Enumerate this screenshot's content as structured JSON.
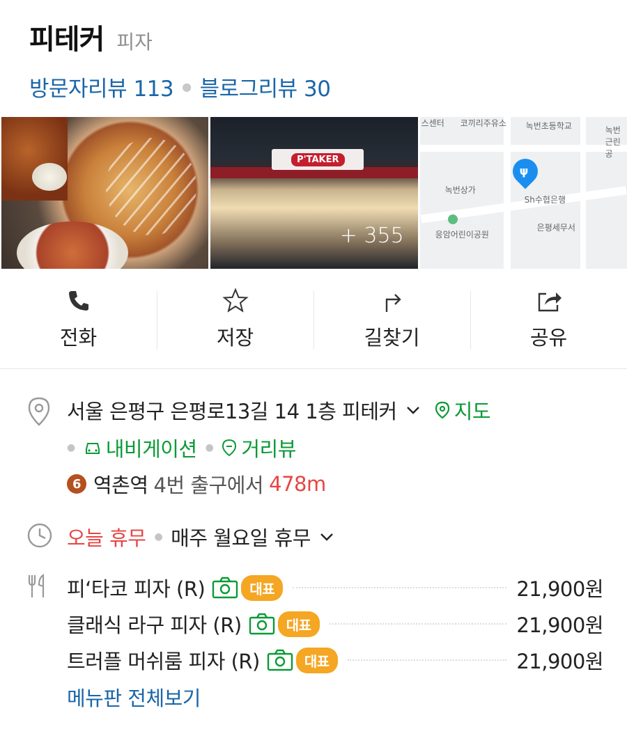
{
  "place": {
    "name": "피테커",
    "category": "피자"
  },
  "reviews": {
    "visitor": "방문자리뷰 113",
    "blog": "블로그리뷰 30"
  },
  "photos": {
    "store_sign": "P'TAKER",
    "more_count": "+ 355",
    "map_labels": [
      "스센터",
      "코끼리주유소",
      "녹번초등학교",
      "녹번근린공",
      "녹번상가",
      "Sh수협은행",
      "은평세무서",
      "응암어린이공원"
    ]
  },
  "actions": [
    {
      "label": "전화",
      "icon": "phone-icon"
    },
    {
      "label": "저장",
      "icon": "star-icon"
    },
    {
      "label": "길찾기",
      "icon": "directions-icon"
    },
    {
      "label": "공유",
      "icon": "share-icon"
    }
  ],
  "address": {
    "text": "서울 은평구 은평로13길 14 1층 피테커",
    "map_link": "지도",
    "navigation_link": "내비게이션",
    "streetview_link": "거리뷰"
  },
  "station": {
    "line_number": "6",
    "name": "역촌역",
    "exit": "4번 출구에서",
    "distance": "478m"
  },
  "hours": {
    "today_status": "오늘 휴무",
    "regular": "매주 월요일 휴무"
  },
  "menu": {
    "items": [
      {
        "name": "피‘타코 피자 (R)",
        "badge": "대표",
        "price": "21,900원"
      },
      {
        "name": "클래식 라구 피자 (R)",
        "badge": "대표",
        "price": "21,900원"
      },
      {
        "name": "트러플 머쉬룸 피자 (R)",
        "badge": "대표",
        "price": "21,900원"
      }
    ],
    "view_all": "메뉴판 전체보기"
  },
  "colors": {
    "link_blue": "#1a66a8",
    "green": "#0a9a36",
    "red": "#e64545",
    "badge_orange": "#f5a623"
  }
}
